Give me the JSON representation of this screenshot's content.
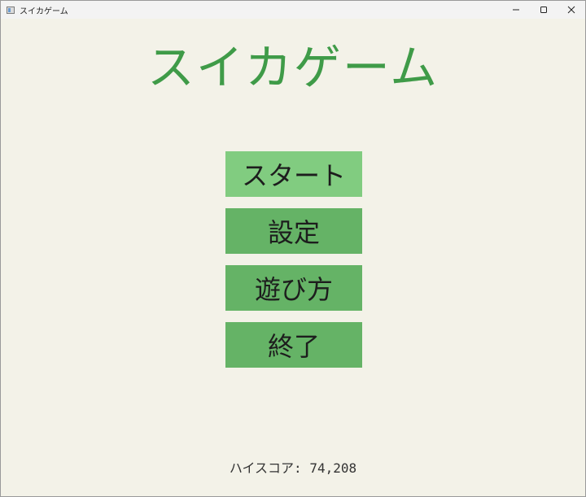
{
  "window": {
    "title": "スイカゲーム",
    "icon": "app-window-icon",
    "controls": [
      "minimize-icon",
      "maximize-icon",
      "close-icon"
    ]
  },
  "game": {
    "title": "スイカゲーム",
    "title_color": "#3f9b48"
  },
  "menu": {
    "selected_index": 0,
    "items": [
      {
        "label": "スタート"
      },
      {
        "label": "設定"
      },
      {
        "label": "遊び方"
      },
      {
        "label": "終了"
      }
    ],
    "colors": {
      "button": "#65b366",
      "selected": "#81cc80",
      "background": "#f3f2e8"
    }
  },
  "footer": {
    "high_score_label": "ハイスコア: 74,208"
  }
}
